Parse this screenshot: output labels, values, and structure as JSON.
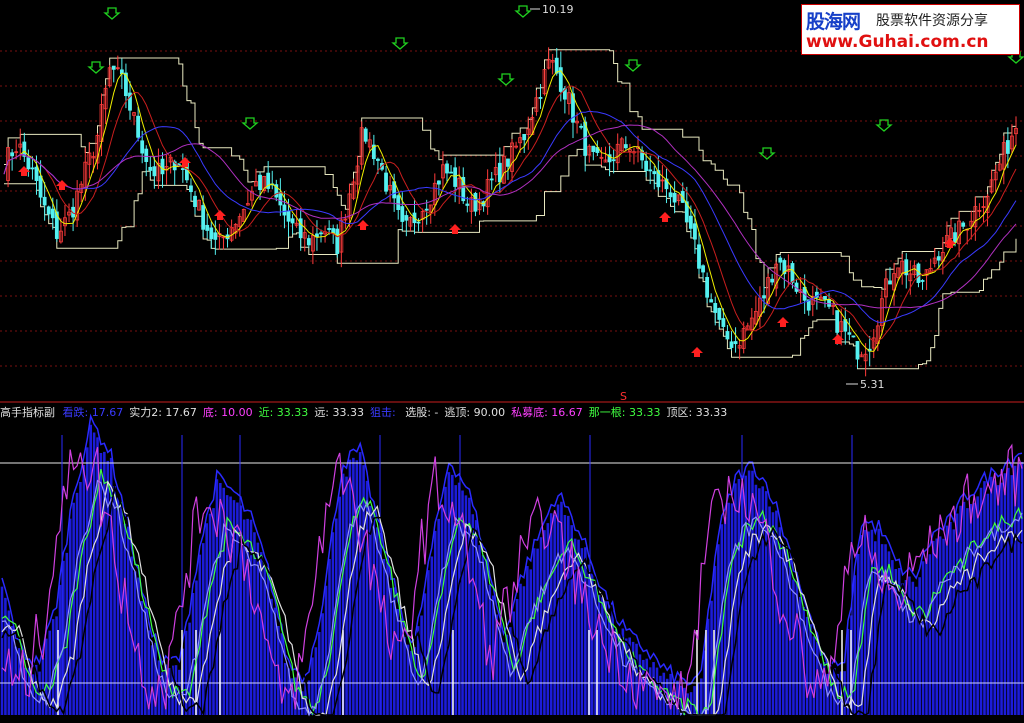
{
  "watermark": {
    "brand": "股海网",
    "subtitle": "股票软件资源分享",
    "url": "www.Guhai.com.cn"
  },
  "top_panel": {
    "high_label": "10.19",
    "low_label": "5.31",
    "s_marker": "S",
    "colors": {
      "up_candle": "#ff3b3b",
      "down_candle": "#54f0f0",
      "ma_yellow": "#f0f000",
      "ma_red": "#c81e1e",
      "ma_blue": "#3a3aff",
      "ma_magenta": "#b030c0",
      "stair_line": "#e8e8c0",
      "signal_up": "#ff2020",
      "signal_down": "#20d020",
      "grid": "#7a1010"
    }
  },
  "legend": {
    "title": "高手指标副",
    "items": [
      {
        "label": "看跌:",
        "value": "17.67",
        "color": "#3a3aff"
      },
      {
        "label": "实力2:",
        "value": "17.67",
        "color": "#e0e0e0"
      },
      {
        "label": "底:",
        "value": "10.00",
        "color": "#ff40ff"
      },
      {
        "label": "近:",
        "value": "33.33",
        "color": "#40ff40"
      },
      {
        "label": "远:",
        "value": "33.33",
        "color": "#e0e0e0"
      },
      {
        "label": "狙击:",
        "value": "",
        "color": "#3a3aff"
      },
      {
        "label": "选股:",
        "value": "-",
        "color": "#e0e0e0"
      },
      {
        "label": "逃顶:",
        "value": "90.00",
        "color": "#e0e0e0"
      },
      {
        "label": "私募底:",
        "value": "16.67",
        "color": "#ff40ff"
      },
      {
        "label": "那一根:",
        "value": "33.33",
        "color": "#40ff40"
      },
      {
        "label": "顶区:",
        "value": "33.33",
        "color": "#e0e0e0"
      }
    ]
  },
  "chart_data": [
    {
      "type": "line",
      "panel": "price",
      "annotations": [
        "10.19",
        "5.31"
      ],
      "series": [
        {
          "values": [
            8.3,
            8.6,
            8.2,
            7.6,
            7.2,
            7.5,
            8.1,
            8.7,
            9.8,
            9.5,
            8.8,
            8.2,
            8.1,
            8.4,
            7.9,
            7.4,
            7.0,
            7.3,
            7.6,
            8.0,
            7.9,
            7.5,
            7.2,
            7.1,
            7.3,
            7.0,
            7.9,
            8.8,
            8.4,
            7.8,
            7.2,
            7.5,
            7.8,
            8.2,
            8.0,
            7.6,
            7.8,
            8.1,
            8.4,
            8.7,
            9.3,
            9.9,
            9.5,
            8.9,
            8.4,
            8.2,
            8.5,
            8.6,
            8.3,
            8.0,
            7.9,
            7.5,
            6.9,
            6.2,
            5.6,
            5.5,
            5.8,
            6.2,
            6.8,
            6.6,
            6.2,
            6.1,
            6.0,
            5.7,
            5.4,
            5.5,
            6.2,
            6.8,
            6.6,
            6.4,
            6.9,
            7.1,
            7.3,
            7.6,
            7.9,
            8.4,
            8.9
          ]
        }
      ]
    },
    {
      "type": "area",
      "panel": "indicator",
      "series": [
        {
          "values": [
            40,
            15,
            10,
            30,
            70,
            95,
            85,
            60,
            30,
            10,
            12,
            50,
            75,
            70,
            60,
            40,
            10,
            5,
            35,
            80,
            85,
            60,
            35,
            15,
            50,
            82,
            72,
            50,
            20,
            40,
            55,
            70,
            60,
            45,
            30,
            20,
            15,
            8,
            4,
            3,
            55,
            75,
            80,
            70,
            50,
            30,
            10,
            8,
            60,
            58,
            45,
            40,
            55,
            60,
            70,
            75,
            80,
            85
          ]
        }
      ]
    }
  ]
}
